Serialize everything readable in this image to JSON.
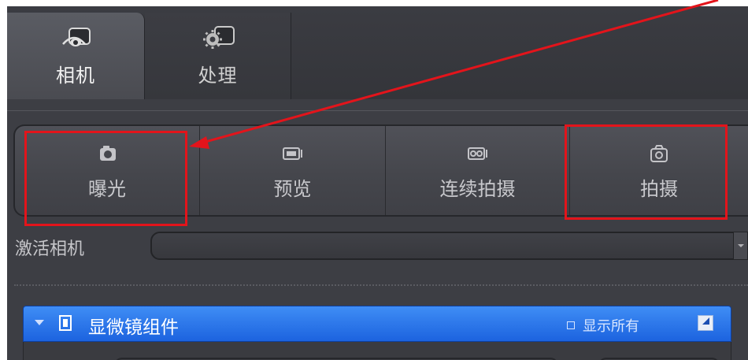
{
  "tabs": [
    {
      "label": "相机",
      "icon": "camera-eye-icon",
      "active": true
    },
    {
      "label": "处理",
      "icon": "gear-process-icon",
      "active": false
    }
  ],
  "actions": [
    {
      "label": "曝光",
      "icon": "camera-icon"
    },
    {
      "label": "预览",
      "icon": "video-preview-icon"
    },
    {
      "label": "连续拍摄",
      "icon": "continuous-capture-icon"
    },
    {
      "label": "拍摄",
      "icon": "snap-icon"
    }
  ],
  "camera_select": {
    "label": "激活相机",
    "value": ""
  },
  "section": {
    "title": "显微镜组件",
    "show_all_label": "显示所有"
  },
  "colors": {
    "panel_bg": "#3a3b40",
    "header_blue": "#2a74ea",
    "annotation_red": "#e3141b"
  }
}
